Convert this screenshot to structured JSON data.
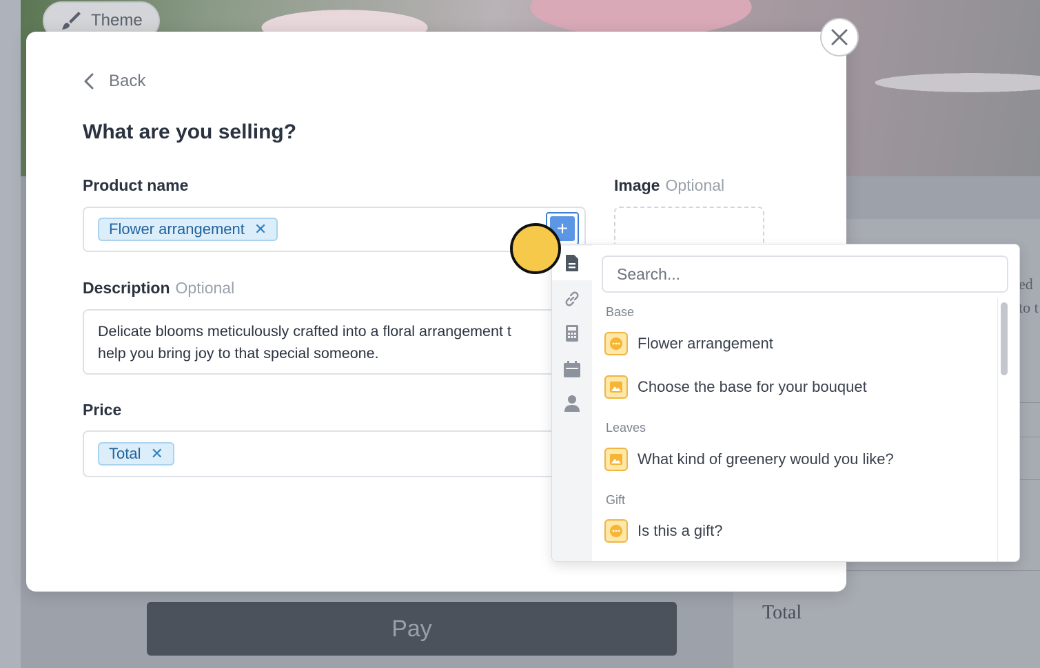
{
  "background": {
    "theme_label": "Theme",
    "pay_label": "Pay",
    "total_label": "Total",
    "snippet_1": "ed",
    "snippet_2": "to t"
  },
  "modal": {
    "back_label": "Back",
    "title": "What are you selling?",
    "product_name": {
      "label": "Product name",
      "chip": "Flower arrangement",
      "chip_remove": "✕"
    },
    "image": {
      "label": "Image",
      "optional": "Optional"
    },
    "description": {
      "label": "Description",
      "optional": "Optional",
      "value": "Delicate blooms meticulously crafted into a floral arrangement t\nhelp you bring joy to that special someone."
    },
    "price": {
      "label": "Price",
      "chip": "Total",
      "chip_remove": "✕"
    },
    "insert_button": "+"
  },
  "dropdown": {
    "search_placeholder": "Search...",
    "rail_icons": [
      "document-icon",
      "link-icon",
      "calculator-icon",
      "calendar-icon",
      "person-icon"
    ],
    "groups": [
      {
        "name": "Base",
        "items": [
          {
            "label": "Flower arrangement",
            "icon": "choice-icon"
          },
          {
            "label": "Choose the base for your bouquet",
            "icon": "image-icon"
          }
        ]
      },
      {
        "name": "Leaves",
        "items": [
          {
            "label": "What kind of greenery would you like?",
            "icon": "image-icon"
          }
        ]
      },
      {
        "name": "Gift",
        "items": [
          {
            "label": "Is this a gift?",
            "icon": "choice-icon"
          }
        ]
      }
    ]
  },
  "colors": {
    "accent": "#5b97e6",
    "chip_bg": "#dbeefa",
    "icon_yellow": "#f6c94b"
  }
}
